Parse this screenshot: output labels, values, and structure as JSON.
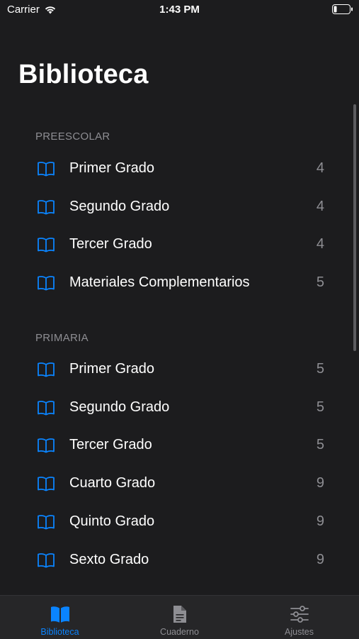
{
  "status_bar": {
    "carrier": "Carrier",
    "time": "1:43 PM"
  },
  "title": "Biblioteca",
  "sections": [
    {
      "header": "PREESCOLAR",
      "items": [
        {
          "label": "Primer Grado",
          "count": "4"
        },
        {
          "label": "Segundo Grado",
          "count": "4"
        },
        {
          "label": "Tercer Grado",
          "count": "4"
        },
        {
          "label": "Materiales Complementarios",
          "count": "5"
        }
      ]
    },
    {
      "header": "PRIMARIA",
      "items": [
        {
          "label": "Primer Grado",
          "count": "5"
        },
        {
          "label": "Segundo Grado",
          "count": "5"
        },
        {
          "label": "Tercer Grado",
          "count": "5"
        },
        {
          "label": "Cuarto Grado",
          "count": "9"
        },
        {
          "label": "Quinto Grado",
          "count": "9"
        },
        {
          "label": "Sexto Grado",
          "count": "9"
        }
      ]
    }
  ],
  "tab_bar": [
    {
      "label": "Biblioteca",
      "icon": "book-icon",
      "active": true
    },
    {
      "label": "Cuaderno",
      "icon": "document-icon",
      "active": false
    },
    {
      "label": "Ajustes",
      "icon": "sliders-icon",
      "active": false
    }
  ],
  "colors": {
    "accent": "#0a84ff",
    "background": "#1c1c1e",
    "secondary_text": "#8e8e93"
  }
}
